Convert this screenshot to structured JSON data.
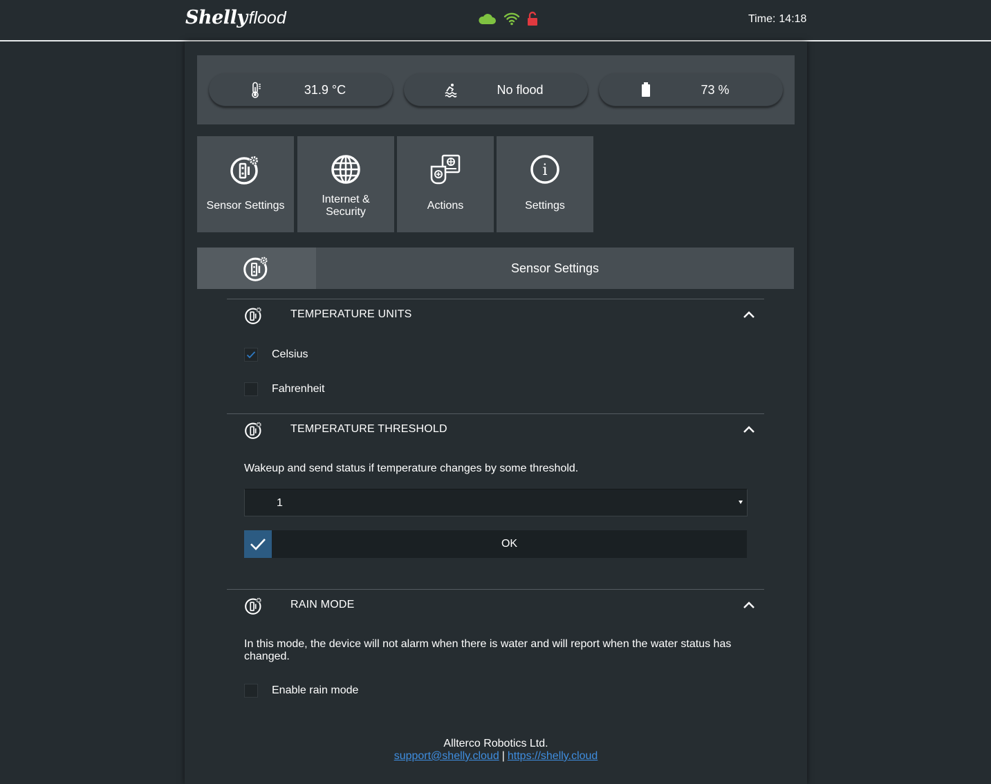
{
  "header": {
    "logo": {
      "brand": "Shelly",
      "product": "flood"
    },
    "status_icons": [
      "cloud-icon",
      "wifi-icon",
      "unlocked-icon"
    ],
    "time_label": "Time:",
    "time_value": "14:18"
  },
  "colors": {
    "cloud": "#7fc241",
    "wifi": "#7fc241",
    "lock": "#e0393f",
    "accent_blue": "#2c5b82",
    "link": "#3f8ee0"
  },
  "status": {
    "temperature": {
      "icon": "thermometer-icon",
      "value": "31.9 °C"
    },
    "flood": {
      "icon": "flood-icon",
      "value": "No flood"
    },
    "battery": {
      "icon": "battery-icon",
      "value": "73 %"
    }
  },
  "nav": {
    "tiles": [
      {
        "icon": "sensor-settings-icon",
        "label": "Sensor Settings"
      },
      {
        "icon": "globe-icon",
        "label": "Internet & Security"
      },
      {
        "icon": "actions-icon",
        "label": "Actions"
      },
      {
        "icon": "info-icon",
        "label": "Settings"
      }
    ]
  },
  "section": {
    "title": "Sensor Settings",
    "icon": "sensor-settings-icon"
  },
  "temperature_units": {
    "title": "TEMPERATURE UNITS",
    "options": [
      {
        "label": "Celsius",
        "checked": true
      },
      {
        "label": "Fahrenheit",
        "checked": false
      }
    ]
  },
  "temperature_threshold": {
    "title": "TEMPERATURE THRESHOLD",
    "description": "Wakeup and send status if temperature changes by some threshold.",
    "selected_value": "1",
    "ok_label": "OK"
  },
  "rain_mode": {
    "title": "RAIN MODE",
    "description": "In this mode, the device will not alarm when there is water and will report when the water status has changed.",
    "checkbox_label": "Enable rain mode",
    "checked": false
  },
  "footer": {
    "company": "Allterco Robotics Ltd.",
    "email": "support@shelly.cloud",
    "separator": "|",
    "website": "https://shelly.cloud"
  }
}
